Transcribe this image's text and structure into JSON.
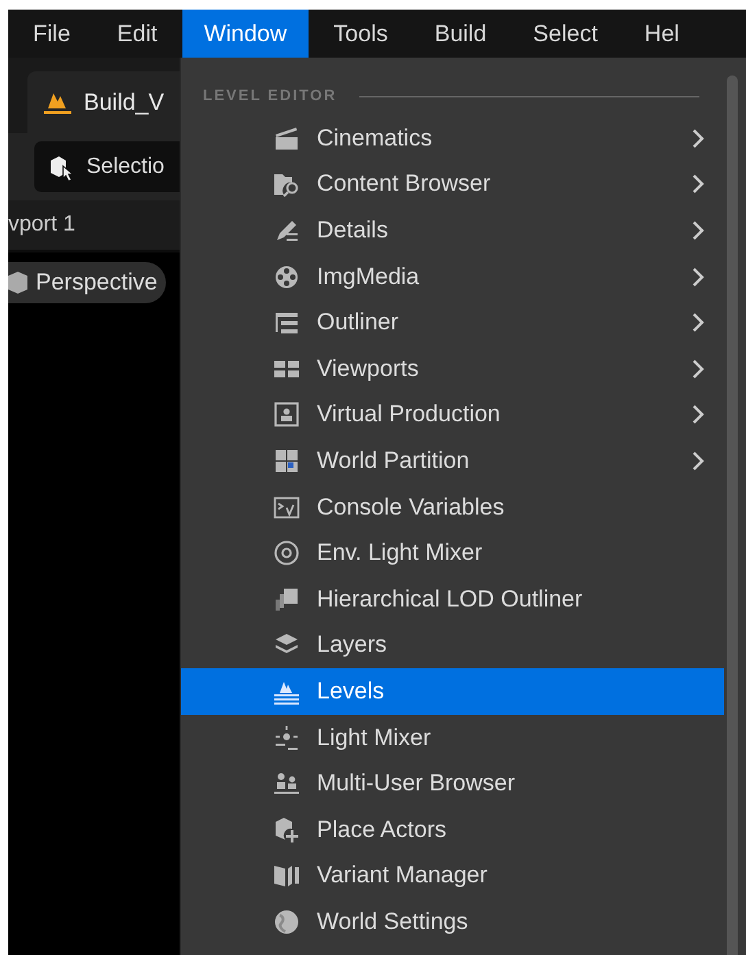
{
  "menu_bar": [
    {
      "label": "File",
      "selected": false
    },
    {
      "label": "Edit",
      "selected": false
    },
    {
      "label": "Window",
      "selected": true
    },
    {
      "label": "Tools",
      "selected": false
    },
    {
      "label": "Build",
      "selected": false
    },
    {
      "label": "Select",
      "selected": false
    },
    {
      "label": "Hel",
      "selected": false
    }
  ],
  "editor": {
    "tab": "Build_V",
    "mode_button": "Selectio",
    "viewport_tab": "vport 1",
    "view_button": "Perspective"
  },
  "dropdown": {
    "section": "LEVEL EDITOR",
    "items": [
      {
        "label": "Cinematics",
        "submenu": true,
        "selected": false
      },
      {
        "label": "Content Browser",
        "submenu": true,
        "selected": false
      },
      {
        "label": "Details",
        "submenu": true,
        "selected": false
      },
      {
        "label": "ImgMedia",
        "submenu": true,
        "selected": false
      },
      {
        "label": "Outliner",
        "submenu": true,
        "selected": false
      },
      {
        "label": "Viewports",
        "submenu": true,
        "selected": false
      },
      {
        "label": "Virtual Production",
        "submenu": true,
        "selected": false
      },
      {
        "label": "World Partition",
        "submenu": true,
        "selected": false
      },
      {
        "label": "Console Variables",
        "submenu": false,
        "selected": false
      },
      {
        "label": "Env. Light Mixer",
        "submenu": false,
        "selected": false
      },
      {
        "label": "Hierarchical LOD Outliner",
        "submenu": false,
        "selected": false
      },
      {
        "label": "Layers",
        "submenu": false,
        "selected": false
      },
      {
        "label": "Levels",
        "submenu": false,
        "selected": true
      },
      {
        "label": "Light Mixer",
        "submenu": false,
        "selected": false
      },
      {
        "label": "Multi-User Browser",
        "submenu": false,
        "selected": false
      },
      {
        "label": "Place Actors",
        "submenu": false,
        "selected": false
      },
      {
        "label": "Variant Manager",
        "submenu": false,
        "selected": false
      },
      {
        "label": "World Settings",
        "submenu": false,
        "selected": false
      }
    ]
  }
}
